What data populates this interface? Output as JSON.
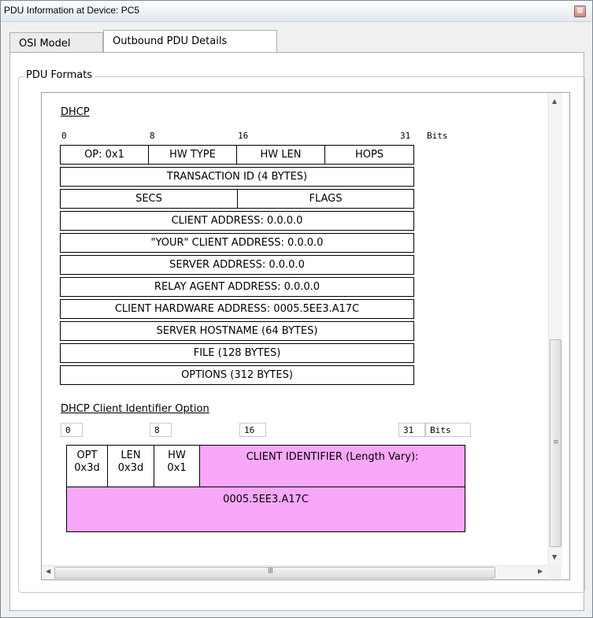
{
  "window": {
    "title": "PDU Information at Device: PC5",
    "close_glyph": "⊠"
  },
  "tabs": [
    {
      "label": "OSI Model"
    },
    {
      "label": "Outbound PDU Details"
    }
  ],
  "groupbox": {
    "label": "PDU Formats"
  },
  "dhcp": {
    "title": "DHCP",
    "bit_ruler": {
      "b0": "0",
      "b8": "8",
      "b16": "16",
      "b31": "31",
      "unit": "Bits"
    },
    "rows": {
      "r1": [
        "OP: 0x1",
        "HW TYPE",
        "HW LEN",
        "HOPS"
      ],
      "r2": "TRANSACTION ID (4 BYTES)",
      "r3": [
        "SECS",
        "FLAGS"
      ],
      "r4": "CLIENT ADDRESS: 0.0.0.0",
      "r5": "\"YOUR\" CLIENT ADDRESS: 0.0.0.0",
      "r6": "SERVER ADDRESS: 0.0.0.0",
      "r7": "RELAY AGENT ADDRESS: 0.0.0.0",
      "r8": "CLIENT HARDWARE ADDRESS: 0005.5EE3.A17C",
      "r9": "SERVER HOSTNAME (64 BYTES)",
      "r10": "FILE (128 BYTES)",
      "r11": "OPTIONS (312 BYTES)"
    }
  },
  "client_id_option": {
    "title": "DHCP Client Identifier Option",
    "bit_ruler": {
      "b0": "0",
      "b8": "8",
      "b16": "16",
      "b31": "31",
      "unit": "Bits"
    },
    "opt": {
      "name": "OPT",
      "value": "0x3d"
    },
    "len": {
      "name": "LEN",
      "value": "0x3d"
    },
    "hw": {
      "name": "HW",
      "value": "0x1"
    },
    "identifier_label": "CLIENT IDENTIFIER (Length Vary):",
    "identifier_value": "0005.5EE3.A17C",
    "highlight_color": "#f9a8f9"
  },
  "scrollbars": {
    "hgrip": "III",
    "vgrip": "≡"
  }
}
